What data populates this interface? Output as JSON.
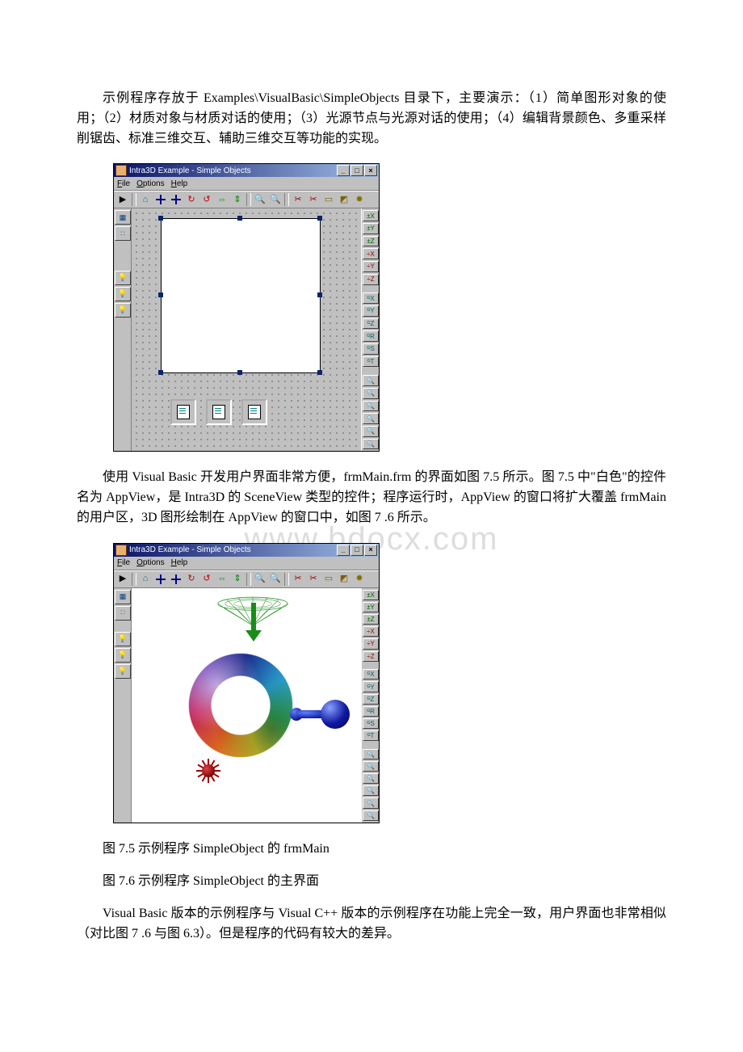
{
  "paragraphs": {
    "p1": "示例程序存放于 Examples\\VisualBasic\\SimpleObjects 目录下，主要演示：（1）简单图形对象的使用；（2）材质对象与材质对话的使用；（3）光源节点与光源对话的使用；（4）编辑背景颜色、多重采样削锯齿、标准三维交互、辅助三维交互等功能的实现。",
    "p2": "使用 Visual Basic 开发用户界面非常方便，frmMain.frm 的界面如图 7.5 所示。图 7.5 中\"白色\"的控件名为 AppView，是 Intra3D 的 SceneView 类型的控件；程序运行时，AppView 的窗口将扩大覆盖 frmMain 的用户区，3D 图形绘制在 AppView 的窗口中，如图 7 .6 所示。",
    "caption75": "图 7.5 示例程序 SimpleObject 的 frmMain",
    "caption76": "图 7.6 示例程序 SimpleObject 的主界面",
    "p3": "Visual Basic 版本的示例程序与 Visual C++ 版本的示例程序在功能上完全一致，用户界面也非常相似（对比图 7 .6 与图 6.3）。但是程序的代码有较大的差异。"
  },
  "app": {
    "title": "Intra3D Example - Simple Objects",
    "menus": {
      "file": "File",
      "options": "Options",
      "help": "Help"
    },
    "win_btns": {
      "min": "_",
      "max": "□",
      "close": "×"
    },
    "toolbar": {
      "play": "▶",
      "reset": "⌂",
      "zoomin": "⊕",
      "zoomout": "⊖",
      "mag1": "🔍",
      "mag2": "🔍",
      "cut1": "✂",
      "cut2": "✂",
      "box": "▭",
      "cube": "◩",
      "gear": "✹"
    },
    "left": {
      "grid": "▦",
      "dots": "∷",
      "light1": "💡",
      "light2": "💡",
      "light3": "💡"
    },
    "right_labels": {
      "tx": "±X",
      "ty": "±Y",
      "tz": "±Z",
      "rx": "÷X",
      "ry": "÷Y",
      "rz": "÷Z",
      "gx": "ᴳX",
      "gy": "ᴳY",
      "gz": "ᴳZ",
      "gr": "ᴳR",
      "gs": "ᴳS",
      "gt": "ᴳT",
      "m1": "🔍",
      "m2": "🔍",
      "m3": "🔍",
      "m4": "🔍",
      "m5": "🔍",
      "m6": "🔍"
    }
  },
  "watermark": "www.bdocx.com"
}
